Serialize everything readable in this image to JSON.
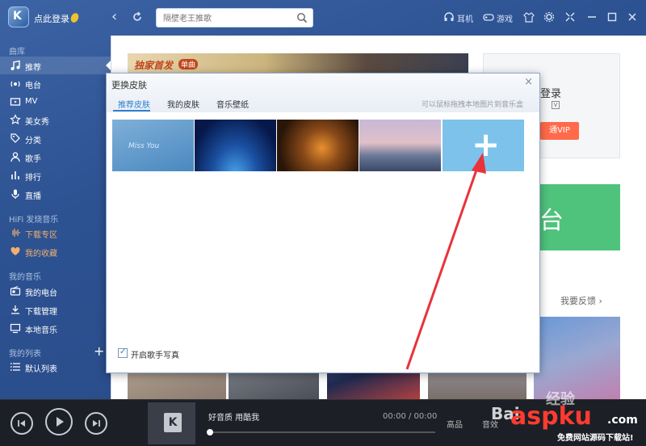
{
  "titlebar": {
    "login": "点此登录",
    "search_placeholder": "隔壁老王推歌",
    "earphone": "耳机",
    "game": "游戏"
  },
  "sidebar": {
    "section_library": "曲库",
    "items": [
      {
        "label": "推荐",
        "icon": "music-note-icon",
        "active": true
      },
      {
        "label": "电台",
        "icon": "radio-icon"
      },
      {
        "label": "MV",
        "icon": "mv-icon"
      },
      {
        "label": "美女秀",
        "icon": "star-icon"
      },
      {
        "label": "分类",
        "icon": "tag-icon"
      },
      {
        "label": "歌手",
        "icon": "user-icon"
      },
      {
        "label": "排行",
        "icon": "rank-icon"
      },
      {
        "label": "直播",
        "icon": "mic-icon"
      }
    ],
    "section_hifi": "HiFi 发烧音乐",
    "hifi_items": [
      {
        "label": "下载专区",
        "icon": "wave-icon"
      },
      {
        "label": "我的收藏",
        "icon": "heart-icon"
      }
    ],
    "section_mymusic": "我的音乐",
    "mymusic_items": [
      {
        "label": "我的电台",
        "icon": "my-radio-icon"
      },
      {
        "label": "下载管理",
        "icon": "download-icon"
      },
      {
        "label": "本地音乐",
        "icon": "monitor-icon"
      }
    ],
    "section_lists": "我的列表",
    "list_items": [
      {
        "label": "默认列表",
        "icon": "list-icon"
      }
    ]
  },
  "main": {
    "banner_text": "独家首发",
    "banner_tag": "单曲",
    "login_box_title": "登录",
    "login_box_badge": "V",
    "login_box_vip": "通VIP",
    "radio_box_title": "台",
    "feedback": "我要反馈 ›"
  },
  "dialog": {
    "title": "更换皮肤",
    "close": "×",
    "tabs": [
      "推荐皮肤",
      "我的皮肤",
      "音乐壁纸"
    ],
    "hint": "可以鼠标拖拽本地图片到音乐盒",
    "skins": [
      "skin-miss-you",
      "skin-blue-earth",
      "skin-snail",
      "skin-sunset-sea"
    ],
    "add_symbol": "+",
    "checkbox_label": "开启歌手写真",
    "miss_you_text": "Miss You"
  },
  "player": {
    "song": "好音质 用酷我",
    "time": "00:00 / 00:00",
    "quality": "高品",
    "effect": "音效"
  },
  "watermark": {
    "brand1": "Bai",
    "brand2": "经验",
    "site": "aspku",
    "domain": ".com",
    "slogan": "免费网站源码下载站!"
  },
  "colors": {
    "sidebar_bg": "#2d5292",
    "accent": "#2f7fd0",
    "vip": "#ff6a4a",
    "radio": "#4fc27c",
    "add_tile": "#7cc2ea",
    "arrow": "#e8333a"
  }
}
